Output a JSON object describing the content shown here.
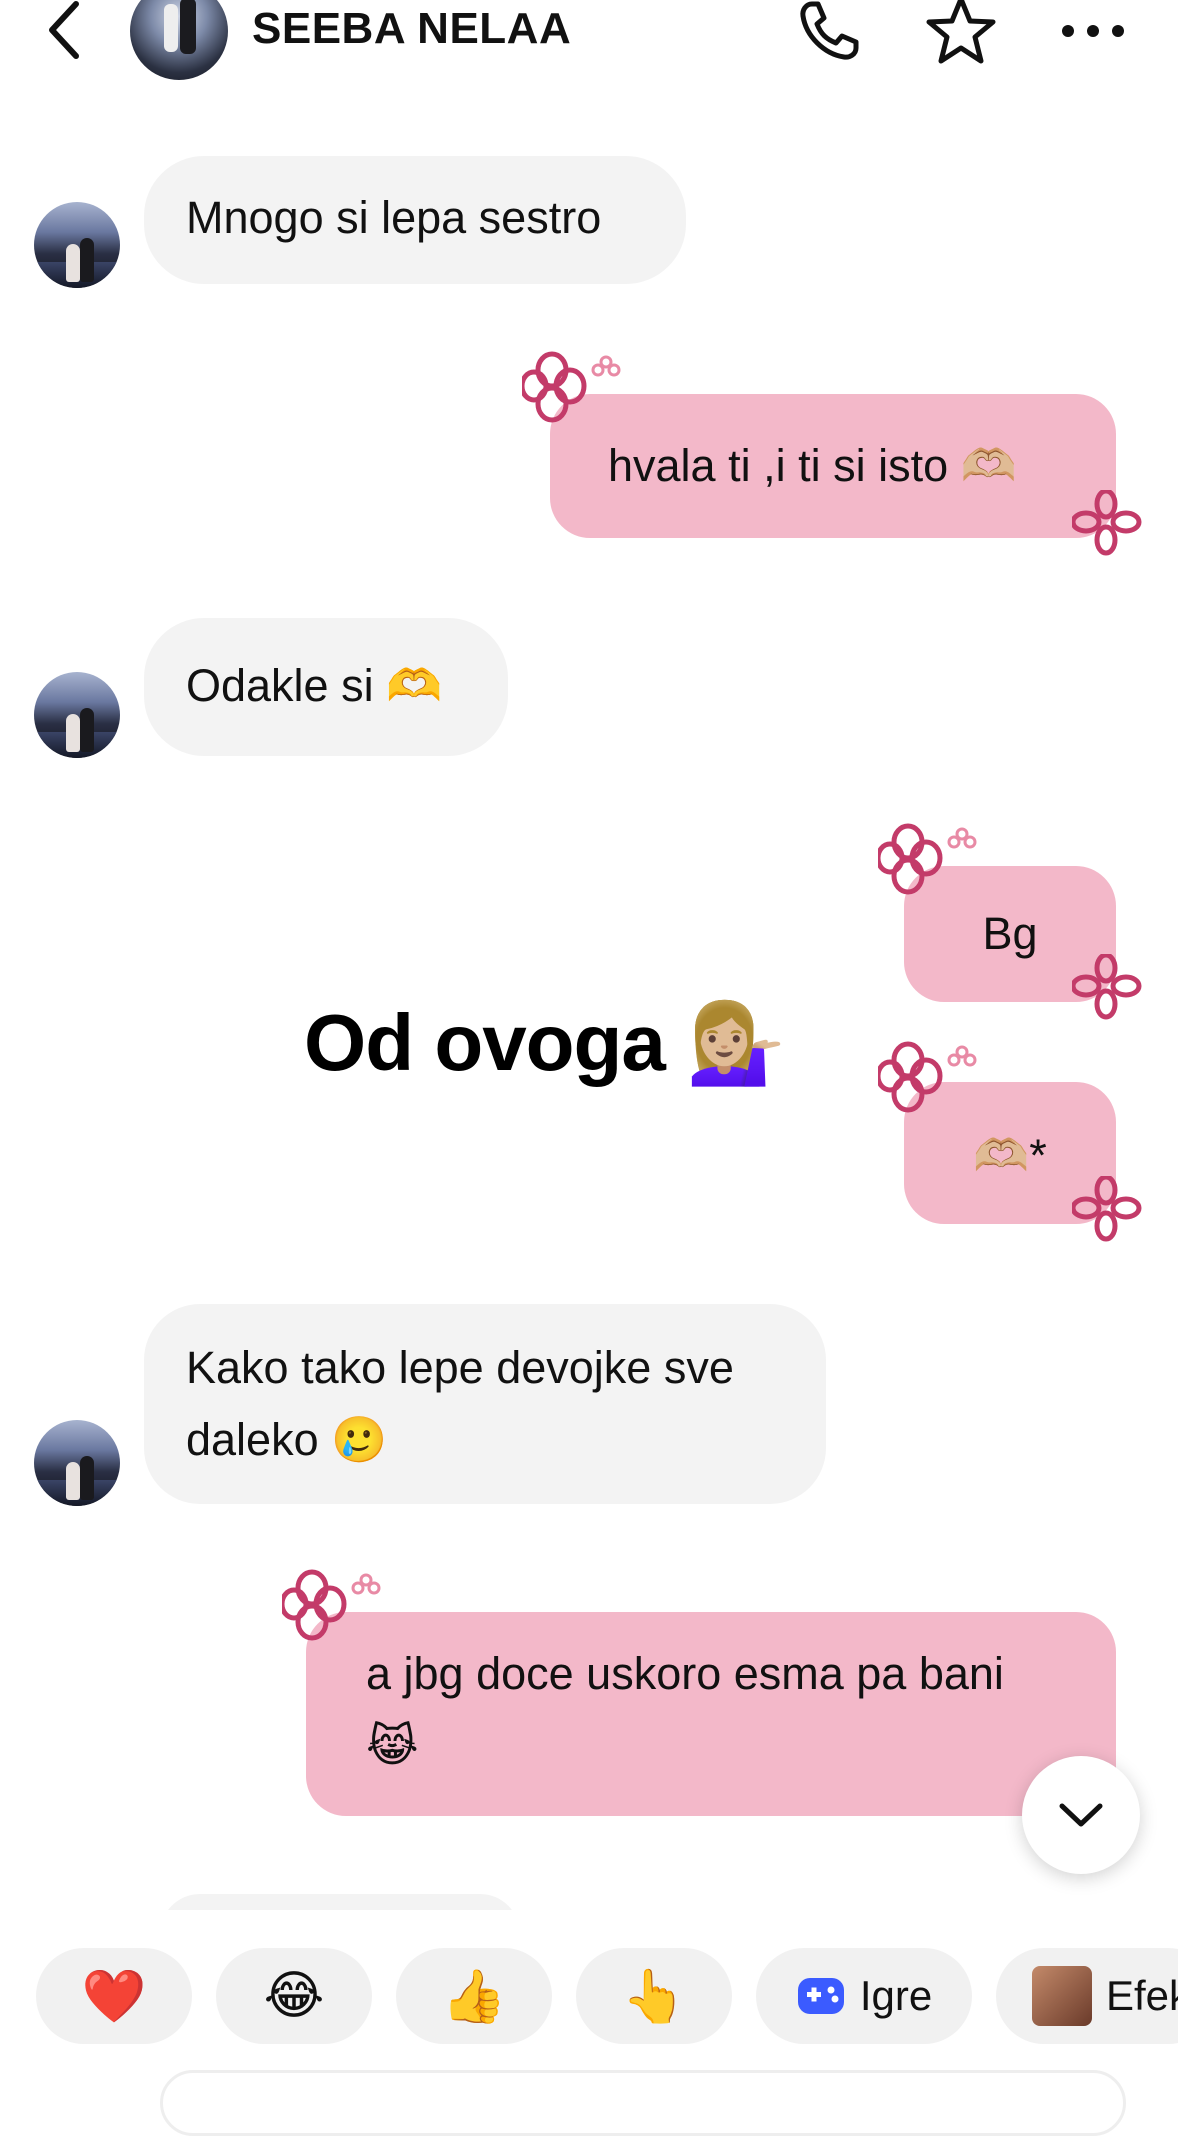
{
  "header": {
    "name": "SEEBA NELAA",
    "icons": [
      "back-icon",
      "phone-icon",
      "star-icon",
      "more-icon"
    ]
  },
  "messages": [
    {
      "side": "in",
      "text": "Mnogo si lepa sestro"
    },
    {
      "side": "out",
      "text": "hvala ti ,i ti si isto 🫶🏼"
    },
    {
      "side": "in",
      "text": "Odakle si 🫶"
    },
    {
      "side": "out",
      "text": "Bg"
    },
    {
      "side": "out",
      "text": "🫶🏼*"
    },
    {
      "side": "in",
      "line1": "Kako tako lepe devojke sve",
      "line2": "daleko 🥲"
    },
    {
      "side": "out",
      "line1": "a jbg doce uskoro esma pa bani",
      "line2": "😹"
    }
  ],
  "overlay_caption": "Od ovoga 💁🏼‍♀️",
  "reactions": [
    {
      "emoji": "❤️"
    },
    {
      "emoji": "😂"
    },
    {
      "emoji": "👍"
    },
    {
      "emoji": "👆"
    },
    {
      "icon": "gamepad-icon",
      "label": "Igre"
    },
    {
      "icon": "effects-thumbnail",
      "label": "Efek"
    }
  ],
  "colors": {
    "incoming_bubble": "#f3f3f3",
    "outgoing_bubble": "#f3b8c9",
    "flower": "#c33b69"
  }
}
